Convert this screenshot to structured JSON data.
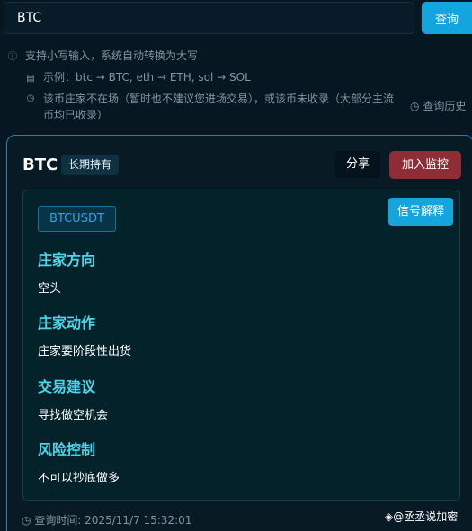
{
  "search": {
    "value": "BTC",
    "button_label": "查询"
  },
  "hints": {
    "line1": "支持小写输入，系统自动转换为大写",
    "line2": "示例：btc → BTC, eth → ETH, sol → SOL",
    "line3a": "该币庄家不在场（暂时也不建议您进场交易），或该币未收录（大部分主流",
    "line3b": "币均已收录）",
    "history_label": "查询历史"
  },
  "card": {
    "title": "BTC",
    "badge": "长期持有",
    "share_label": "分享",
    "monitor_label": "加入监控",
    "symbol": "BTCUSDT",
    "explain_label": "信号解释",
    "sections": [
      {
        "title": "庄家方向",
        "text": "空头"
      },
      {
        "title": "庄家动作",
        "text": "庄家要阶段性出货"
      },
      {
        "title": "交易建议",
        "text": "寻找做空机会"
      },
      {
        "title": "风险控制",
        "text": "不可以抄底做多"
      }
    ]
  },
  "footer": {
    "query_time": "查询时间: 2025/11/7 15:32:01",
    "watermark": "@丞丞说加密"
  },
  "colors": {
    "background": "#061722",
    "accent": "#13a6de",
    "danger": "#8f2d37",
    "section_title": "#4ad7ea"
  },
  "icons": {
    "info": "info-icon",
    "document": "document-icon",
    "clock": "clock-icon",
    "binance": "binance-logo-icon"
  }
}
